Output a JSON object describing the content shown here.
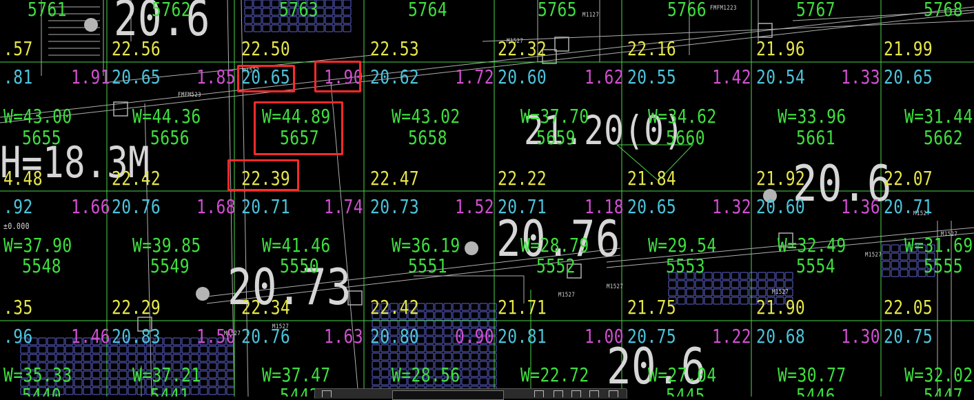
{
  "colors": {
    "background": "#000000",
    "grid": "#4cd64c",
    "green_text": "#3ee03e",
    "yellow_text": "#e6e64a",
    "cyan_text": "#4cc4dc",
    "magenta_text": "#d24fd2",
    "white_text": "#d6d6d6",
    "highlight": "#ff2a2a",
    "seats": "#5f63d0",
    "walls": "#b0b0b0"
  },
  "annotations": {
    "room_ids_top": [
      "5761",
      "5762",
      "5763",
      "5764",
      "5765",
      "5766",
      "5767",
      "5768"
    ],
    "room_labels": [
      {
        "w": "W=43.00",
        "id": "5655"
      },
      {
        "w": "W=44.36",
        "id": "5656"
      },
      {
        "w": "W=44.89",
        "id": "5657"
      },
      {
        "w": "W=43.02",
        "id": "5658"
      },
      {
        "w": "W=37.70",
        "id": "5659"
      },
      {
        "w": "W=34.62",
        "id": "5660"
      },
      {
        "w": "W=33.96",
        "id": "5661"
      },
      {
        "w": "W=31.44",
        "id": "5662"
      },
      {
        "w": "W=37.90",
        "id": "5548"
      },
      {
        "w": "W=39.85",
        "id": "5549"
      },
      {
        "w": "W=41.46",
        "id": "5550"
      },
      {
        "w": "W=36.19",
        "id": "5551"
      },
      {
        "w": "W=28.79",
        "id": "5552"
      },
      {
        "w": "W=29.54",
        "id": "5553"
      },
      {
        "w": "W=32.49",
        "id": "5554"
      },
      {
        "w": "W=31.69",
        "id": "5555"
      },
      {
        "w": "W=35.33",
        "id": "5440"
      },
      {
        "w": "W=37.21",
        "id": "5441"
      },
      {
        "w": "W=37.47",
        "id": "5442"
      },
      {
        "w": "W=28.56",
        "id": "5443"
      },
      {
        "w": "W=22.72",
        "id": "5444"
      },
      {
        "w": "W=27.04",
        "id": "5445"
      },
      {
        "w": "W=30.77",
        "id": "5446"
      },
      {
        "w": "W=32.02",
        "id": "5447"
      }
    ],
    "elev_yellow_row1": [
      ".57",
      "22.56",
      "22.50",
      "22.53",
      "22.32",
      "22.16",
      "21.96",
      "21.99"
    ],
    "elev_yellow_row2": [
      "4.48",
      "22.42",
      "22.39",
      "22.47",
      "22.22",
      "21.84",
      "21.92",
      "22.07"
    ],
    "elev_yellow_row3": [
      ".35",
      "22.29",
      "22.34",
      "22.42",
      "21.71",
      "21.75",
      "21.90",
      "22.05"
    ],
    "elev_cyan_row1": [
      ".81",
      "20.65",
      "20.65",
      "20.62",
      "20.60",
      "20.55",
      "20.54",
      "20.65"
    ],
    "elev_cyan_row2": [
      ".92",
      "20.76",
      "20.71",
      "20.73",
      "20.71",
      "20.65",
      "20.60",
      "20.71"
    ],
    "elev_cyan_row3": [
      ".96",
      "20.83",
      "20.76",
      "20.80",
      "20.81",
      "20.75",
      "20.68",
      "20.75"
    ],
    "depth_magenta_row1": [
      "1.91",
      "1.85",
      "1.90",
      "1.72",
      "1.62",
      "1.42",
      "1.33"
    ],
    "depth_magenta_row2": [
      "1.66",
      "1.68",
      "1.74",
      "1.52",
      "1.18",
      "1.32",
      "1.36"
    ],
    "depth_magenta_row3": [
      "1.46",
      "1.50",
      "1.63",
      "0.90",
      "1.00",
      "1.22",
      "1.30"
    ],
    "big_text": {
      "h_label": "H=18.3M",
      "contour_a": "20.6",
      "contour_b": "21.20(0)",
      "contour_c": "20.6",
      "contour_d": "20.76",
      "contour_e": "20.73",
      "contour_f": "20.6",
      "zero_mark": "±0.000"
    },
    "door_tags": [
      "M1527",
      "FMFM523",
      "M1527",
      "M1127",
      "FMFM1223",
      "M1527",
      "M1527",
      "M1527",
      "M1527",
      "M1527",
      "M1527",
      "M1527",
      "M1527"
    ]
  },
  "toolbar": {
    "visible": "partial",
    "icons": [
      "layer-icon",
      "arrow-icon",
      "move-icon",
      "copy-icon",
      "paste-icon"
    ]
  }
}
